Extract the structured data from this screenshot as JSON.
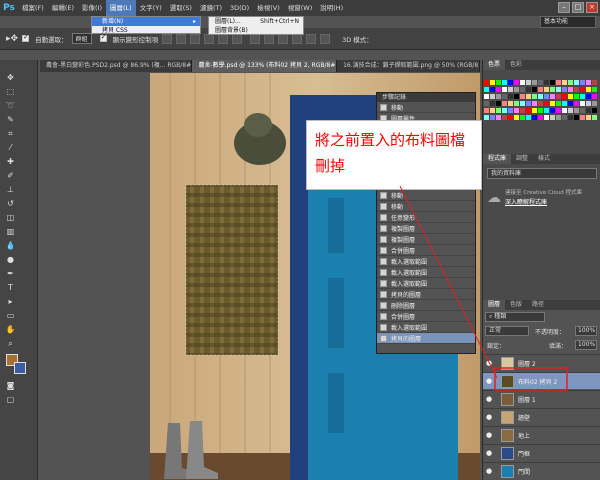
{
  "app": {
    "logo": "Ps"
  },
  "menubar": {
    "items": [
      "檔案(F)",
      "編輯(E)",
      "影像(I)",
      "圖層(L)",
      "文字(Y)",
      "選取(S)",
      "濾鏡(T)",
      "3D(D)",
      "檢視(V)",
      "視窗(W)",
      "說明(H)"
    ],
    "active_index": 3
  },
  "layer_menu": {
    "items": [
      {
        "label": "新增(N)",
        "highlighted": true,
        "has_submenu": true
      },
      {
        "label": "拷貝 CSS",
        "highlighted": false,
        "has_submenu": false
      }
    ]
  },
  "new_submenu": {
    "items": [
      {
        "label": "圖層(L)...",
        "shortcut": "Shift+Ctrl+N"
      },
      {
        "label": "圖層背景(B)",
        "shortcut": ""
      }
    ]
  },
  "options_bar": {
    "auto_select_label": "自動選取：",
    "auto_select_value": "群組",
    "transform_label": "顯示變形控制項",
    "mode_3d": "3D 模式："
  },
  "workspace": {
    "label": "基本功能"
  },
  "doc_tabs": [
    "農會-黑白變彩色.PSD2.psd @ 86.9% (複... RGB/8#)",
    "農舍-數學.psd @ 133% (布料02 拷貝 2, RGB/8#)",
    "16.演技合成：鎖子擷取範圍.png @ 50% (RGB/8)"
  ],
  "right_panel": {
    "swatch_tabs": [
      "色票",
      "色彩"
    ],
    "lib_tabs": [
      "程式庫",
      "調整",
      "樣式"
    ],
    "lib_select": "我的資料庫",
    "cc_text": "連接至 Creative Cloud 程式庫",
    "cc_link": "深入瞭解程式庫",
    "layers_tabs": [
      "圖層",
      "色版",
      "路徑"
    ],
    "kind_label": "種類",
    "blend_mode": "正常",
    "opacity_label": "不透明度：",
    "opacity_value": "100%",
    "lock_label": "鎖定：",
    "fill_label": "填滿：",
    "fill_value": "100%"
  },
  "history_panel": {
    "title": "步驟記錄",
    "items": [
      "移動",
      "圖層屬性",
      "移動",
      "移動",
      "移動",
      "移動",
      "移動",
      "移動",
      "移動",
      "移動",
      "任意變形",
      "複製圖層",
      "複製圖層",
      "合併圖層",
      "載入選取範圍",
      "載入選取範圍",
      "載入選取範圍",
      "拷貝的圖層",
      "刪除圖層",
      "合併圖層",
      "載入選取範圍",
      "拷貝的圖層"
    ],
    "selected_index": 21
  },
  "annotation": {
    "line1": "將之前置入的布料圖檔",
    "line2": "刪掉"
  },
  "layers": [
    {
      "name": "圖層 2",
      "selected": false
    },
    {
      "name": "布料02 拷貝 2",
      "selected": true
    },
    {
      "name": "圖層 1",
      "selected": false
    },
    {
      "name": "牆壁",
      "selected": false
    },
    {
      "name": "地上",
      "selected": false
    },
    {
      "name": "門框",
      "selected": false
    },
    {
      "name": "門間",
      "selected": false
    }
  ],
  "colors": {
    "accent": "#4d79b8",
    "annotation_text": "#ff0000",
    "highlight_box": "#e02020",
    "door_blue": "#1b7fb0"
  }
}
